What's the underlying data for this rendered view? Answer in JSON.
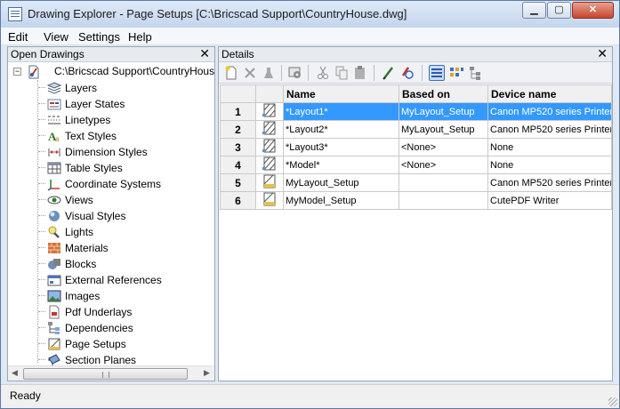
{
  "window": {
    "title": "Drawing Explorer - Page Setups [C:\\Bricscad Support\\CountryHouse.dwg]"
  },
  "menu": [
    "Edit",
    "View",
    "Settings",
    "Help"
  ],
  "left_pane": {
    "title": "Open Drawings",
    "close_glyph": "✕",
    "root_label": "C:\\Bricscad Support\\CountryHouse",
    "items": [
      {
        "label": "Layers",
        "icon": "layers-icon"
      },
      {
        "label": "Layer States",
        "icon": "layer-states-icon"
      },
      {
        "label": "Linetypes",
        "icon": "linetypes-icon"
      },
      {
        "label": "Text Styles",
        "icon": "text-styles-icon"
      },
      {
        "label": "Dimension Styles",
        "icon": "dimension-styles-icon"
      },
      {
        "label": "Table Styles",
        "icon": "table-styles-icon"
      },
      {
        "label": "Coordinate Systems",
        "icon": "coordinate-systems-icon"
      },
      {
        "label": "Views",
        "icon": "views-icon"
      },
      {
        "label": "Visual Styles",
        "icon": "visual-styles-icon"
      },
      {
        "label": "Lights",
        "icon": "lights-icon"
      },
      {
        "label": "Materials",
        "icon": "materials-icon"
      },
      {
        "label": "Blocks",
        "icon": "blocks-icon"
      },
      {
        "label": "External References",
        "icon": "external-references-icon"
      },
      {
        "label": "Images",
        "icon": "images-icon"
      },
      {
        "label": "Pdf Underlays",
        "icon": "pdf-underlays-icon"
      },
      {
        "label": "Dependencies",
        "icon": "dependencies-icon"
      },
      {
        "label": "Page Setups",
        "icon": "page-setups-icon"
      },
      {
        "label": "Section Planes",
        "icon": "section-planes-icon"
      }
    ]
  },
  "right_pane": {
    "title": "Details",
    "close_glyph": "✕",
    "columns": [
      "Name",
      "Based on",
      "Device name"
    ],
    "rows": [
      {
        "num": "1",
        "name": "*Layout1*",
        "based_on": "MyLayout_Setup",
        "device": "Canon MP520 series Printer",
        "kind": "layout",
        "selected": true
      },
      {
        "num": "2",
        "name": "*Layout2*",
        "based_on": "MyLayout_Setup",
        "device": "Canon MP520 series Printer",
        "kind": "layout",
        "selected": false
      },
      {
        "num": "3",
        "name": "*Layout3*",
        "based_on": "<None>",
        "device": "None",
        "kind": "layout",
        "selected": false
      },
      {
        "num": "4",
        "name": "*Model*",
        "based_on": "<None>",
        "device": "None",
        "kind": "layout",
        "selected": false
      },
      {
        "num": "5",
        "name": "MyLayout_Setup",
        "based_on": "",
        "device": "Canon MP520 series Printer",
        "kind": "setup",
        "selected": false
      },
      {
        "num": "6",
        "name": "MyModel_Setup",
        "based_on": "",
        "device": "CutePDF Writer",
        "kind": "setup",
        "selected": false
      }
    ]
  },
  "status": {
    "text": "Ready"
  },
  "colors": {
    "selection": "#3399ff",
    "window_border": "#5a7aa6"
  }
}
